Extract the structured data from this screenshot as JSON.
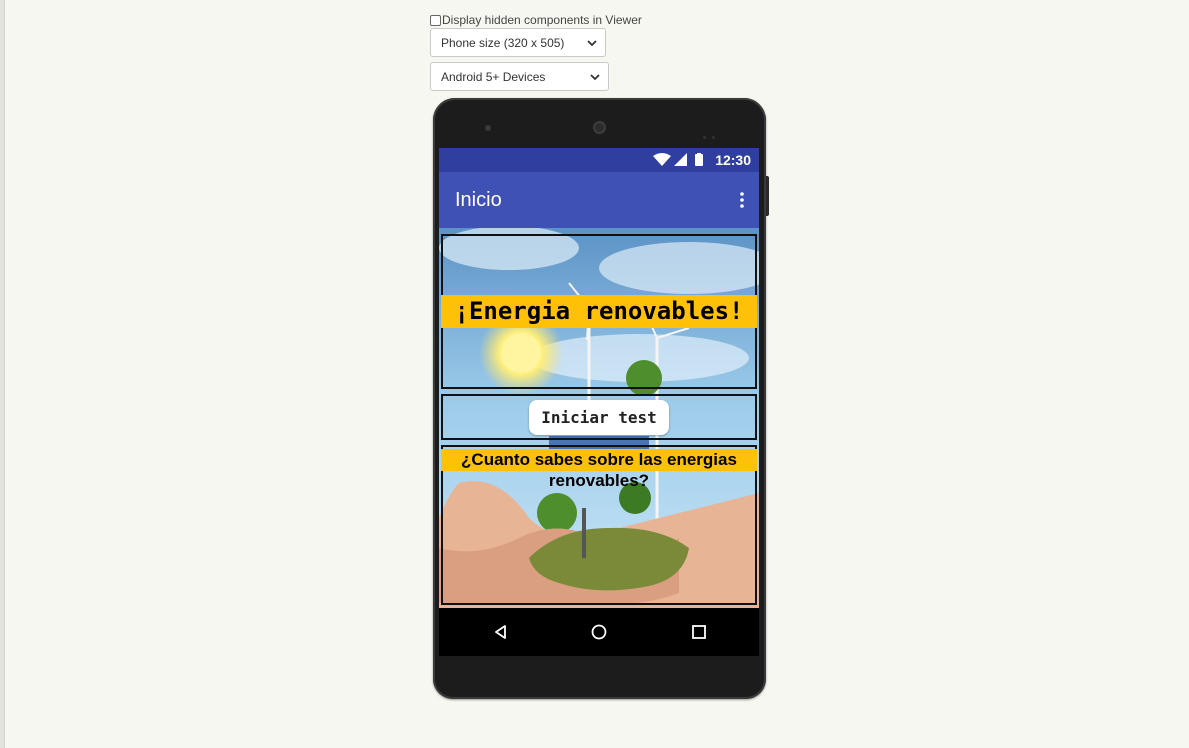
{
  "viewer_options": {
    "hidden_components_label": "Display hidden components in Viewer",
    "hidden_components_checked": false,
    "screen_size_select": "Phone size (320 x 505)",
    "device_theme_select": "Android 5+ Devices"
  },
  "status_bar": {
    "time": "12:30",
    "icons": [
      "wifi-icon",
      "signal-icon",
      "battery-icon"
    ]
  },
  "app_bar": {
    "title": "Inicio",
    "menu_icon": "overflow-menu-icon"
  },
  "content": {
    "title_banner": "¡Energia renovables!",
    "start_button": "Iniciar test",
    "question_banner": "¿Cuanto sabes sobre las energias renovables?"
  },
  "nav_bar": {
    "icons": [
      "back-icon",
      "home-icon",
      "recents-icon"
    ]
  },
  "colors": {
    "status_bar": "#303f9f",
    "app_bar": "#3f51b5",
    "banner": "#ffc107",
    "page_background": "#f7f7f2"
  }
}
